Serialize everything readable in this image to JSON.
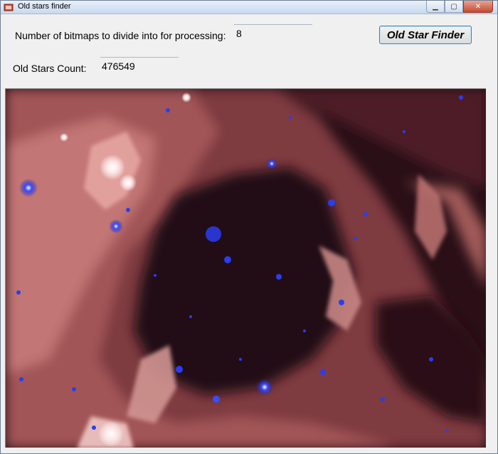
{
  "window": {
    "title": "Old stars finder"
  },
  "form": {
    "bitmaps_label": "Number of bitmaps to divide into for processing:",
    "bitmaps_value": "8",
    "count_label": "Old Stars Count:",
    "count_value": "476549",
    "finder_button": "Old Star Finder"
  },
  "image": {
    "subject": "nebula starfield with old stars highlighted in blue"
  },
  "colors": {
    "nebula": "#b86a68",
    "void": "#2c1018",
    "highlight": "#2a3df0"
  }
}
